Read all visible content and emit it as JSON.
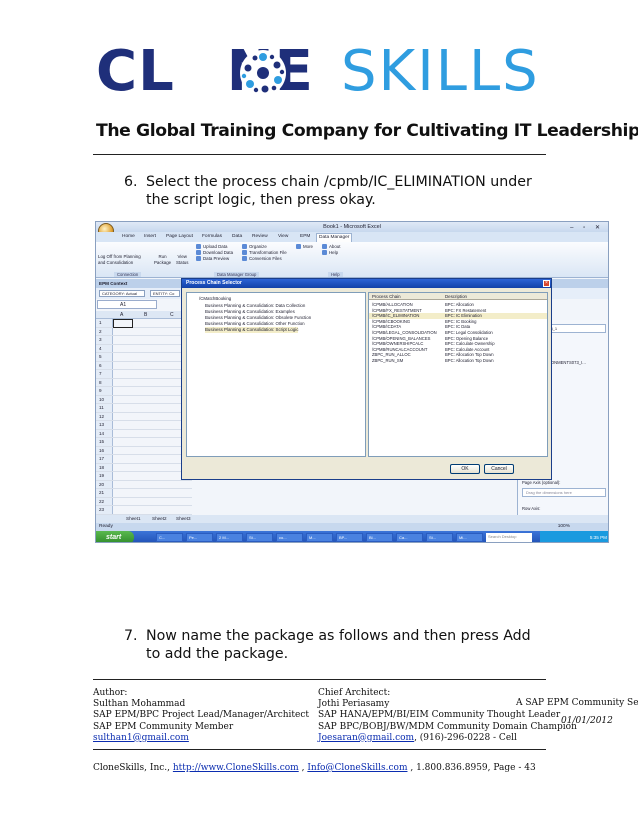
{
  "brand": {
    "name_part1": "CL",
    "name_part2": "NE",
    "name_part3": "SKILLS",
    "tagline": "The Global Training Company for Cultivating IT Leadership",
    "colors": {
      "navy": "#1f2f7a",
      "sky": "#2f9de0"
    }
  },
  "steps": [
    {
      "num": "6.",
      "text": "Select the process chain /cpmb/IC_ELIMINATION under the script logic, then press okay."
    },
    {
      "num": "7.",
      "text": "Now name the package as follows and then press Add to add the package."
    }
  ],
  "screenshot": {
    "window_title": "Book1 - Microsoft Excel",
    "tabs": [
      "Home",
      "Insert",
      "Page Layout",
      "Formulas",
      "Data",
      "Review",
      "View",
      "EPM",
      "Data Manager"
    ],
    "ribbon": {
      "groups": [
        {
          "lines": [
            "Log Off from Planning",
            "and Consolidation"
          ]
        },
        {
          "lines": [
            "Run",
            "Package"
          ]
        },
        {
          "lines": [
            "View",
            "Status"
          ]
        },
        {
          "lines": [
            "Upload Data",
            "Download Data",
            "Data Preview"
          ]
        },
        {
          "lines": [
            "Organize",
            "Transformation File",
            "Conversion Files"
          ]
        },
        {
          "lines": [
            "More"
          ]
        },
        {
          "lines": [
            "About",
            "Help"
          ]
        }
      ],
      "footers": [
        "Connection",
        "Data Manager Group",
        "Help"
      ]
    },
    "epm_context": "EPM Context",
    "context_fields": [
      "CATEGORY: Actual",
      "ENTITY: Co"
    ],
    "name_box": "A1",
    "columns": [
      "A",
      "B",
      "C"
    ],
    "rows": [
      "1",
      "2",
      "3",
      "4",
      "5",
      "6",
      "7",
      "8",
      "9",
      "10",
      "11",
      "12",
      "13",
      "14",
      "15",
      "16",
      "17",
      "18",
      "19",
      "20",
      "21",
      "22",
      "23"
    ],
    "sheet_tabs": [
      "Sheet1",
      "Sheet2",
      "Sheet3"
    ],
    "status": "Ready",
    "zoom": "100%",
    "start": "start",
    "search_placeholder": "Search Desktop",
    "clock": "5:35 PM",
    "task_items": [
      "C...",
      "Pe...",
      "2 M...",
      "St...",
      "co...",
      "M...",
      "BP...",
      "Bl...",
      "Ca...",
      "St...",
      "Mi..."
    ],
    "right_pane": {
      "field1": "ONMENTS073_1",
      "field2": "ooking - ENVIRONMENTS073_I...",
      "page_axis_label": "Page Axis (optional):",
      "page_axis_placeholder": "Drag the dimensions here",
      "row_axis_label": "Row Axis:"
    },
    "dialog": {
      "title": "Process Chain Selector",
      "tree_root": "/CMatchBooking",
      "tree_items": [
        "Business Planning & Consolidation: Data Collection",
        "Business Planning & Consolidation: Examples",
        "Business Planning & Consolidation: Obsolete Function",
        "Business Planning & Consolidation: Other Function",
        "Business Planning & Consolidation: Script Logic"
      ],
      "headers": [
        "Process Chain",
        "Description"
      ],
      "chains": [
        [
          "/CPMB/ALLOCATION",
          "BPC: Allocation"
        ],
        [
          "/CPMB/FX_RESTATMENT",
          "BPC: FX Restatement"
        ],
        [
          "/CPMB/IC_ELIMINATION",
          "BPC: IC Elimination"
        ],
        [
          "/CPMB/ICBOOKING",
          "BPC: IC Booking"
        ],
        [
          "/CPMB/ICDATA",
          "BPC: IC Data"
        ],
        [
          "/CPMB/LEGAL_CONSOLIDATION",
          "BPC: Legal Consolidation"
        ],
        [
          "/CPMB/OPENING_BALANCES",
          "BPC: Opening Balance"
        ],
        [
          "/CPMB/OWNERSHIPCALC",
          "BPC: Calculate Ownership"
        ],
        [
          "/CPMB/RUNCALCACCOUNT",
          "BPC: Calculate Account"
        ],
        [
          "ZBPC_RUN_ALLOC",
          "BPC: Allocation Top Down"
        ],
        [
          "ZBPC_RUN_SM",
          "BPC: Allocation Top Down"
        ]
      ],
      "ok": "OK",
      "cancel": "Cancel"
    }
  },
  "footer": {
    "author_label": "Author:",
    "author_name": "Sulthan Mohammad",
    "author_role": "SAP EPM/BPC Project Lead/Manager/Architect",
    "author_member": "SAP EPM Community Member",
    "author_email": "sulthan1@gmail.com",
    "chief_label": "Chief Architect:",
    "chief_name": "Jothi Periasamy",
    "chief_role1": "SAP HANA/EPM/BI/EIM Community Thought Leader",
    "chief_role2": "SAP BPC/BOBJ/BW/MDM Community Domain Champion",
    "chief_email": "Joesaran@gmail.com",
    "chief_phone": ", (916)-296-0228 - Cell",
    "service": "A SAP EPM Community Services",
    "date": "01/01/2012",
    "company": "CloneSkills, Inc.,",
    "site": "http://www.CloneSkills.com",
    "sep1": ",",
    "info_email": "Info@CloneSkills.com",
    "phone_page": ", 1.800.836.8959, Page - 43"
  }
}
